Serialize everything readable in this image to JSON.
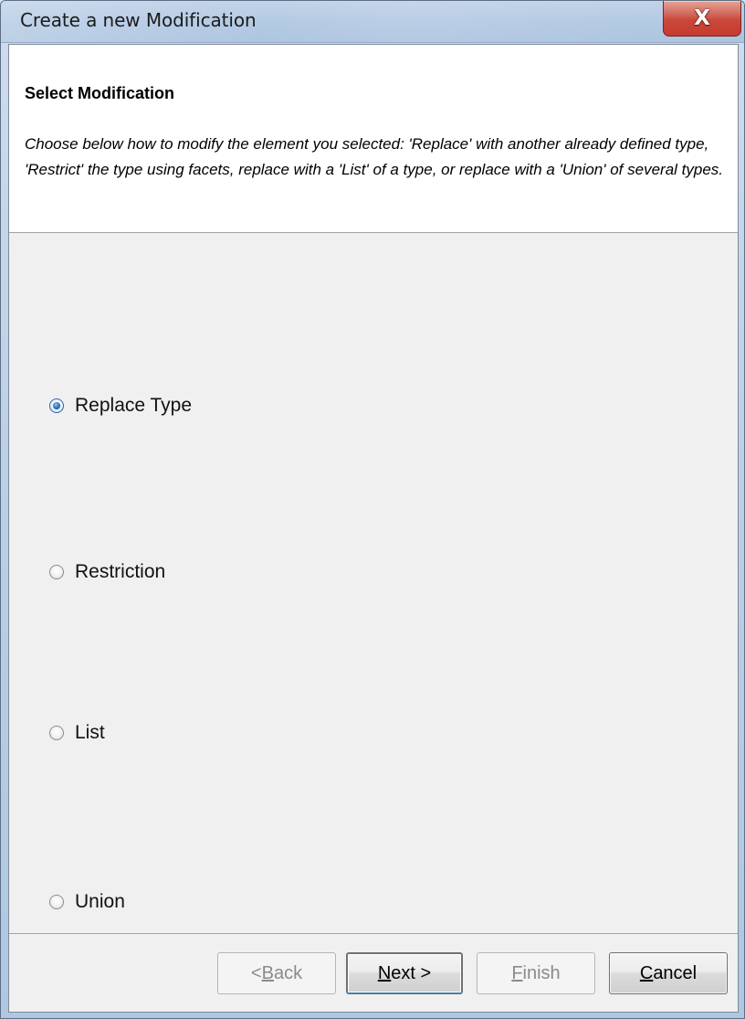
{
  "window": {
    "title": "Create a new Modification",
    "close_icon": "X",
    "close_icon_name": "close-icon"
  },
  "header": {
    "title": "Select Modification",
    "description": "Choose below how to modify the element you selected: 'Replace' with another already defined type, 'Restrict' the type using facets, replace with a 'List' of a type, or replace with a 'Union' of several types."
  },
  "options": [
    {
      "label": "Replace Type",
      "checked": true
    },
    {
      "label": "Restriction",
      "checked": false
    },
    {
      "label": "List",
      "checked": false
    },
    {
      "label": "Union",
      "checked": false
    }
  ],
  "buttons": {
    "back": {
      "prefix": "< ",
      "mnemonic": "B",
      "rest": "ack",
      "enabled": false
    },
    "next": {
      "mnemonic": "N",
      "rest": "ext >",
      "enabled": true
    },
    "finish": {
      "mnemonic": "F",
      "rest": "inish",
      "enabled": false
    },
    "cancel": {
      "mnemonic": "C",
      "rest": "ancel",
      "enabled": true
    }
  },
  "colors": {
    "title_bar": "#aec6e2",
    "close_button": "#c9483a",
    "header_background": "#ffffff",
    "content_background": "#f0f0f0",
    "selected_radio": "#2b6cb0"
  }
}
